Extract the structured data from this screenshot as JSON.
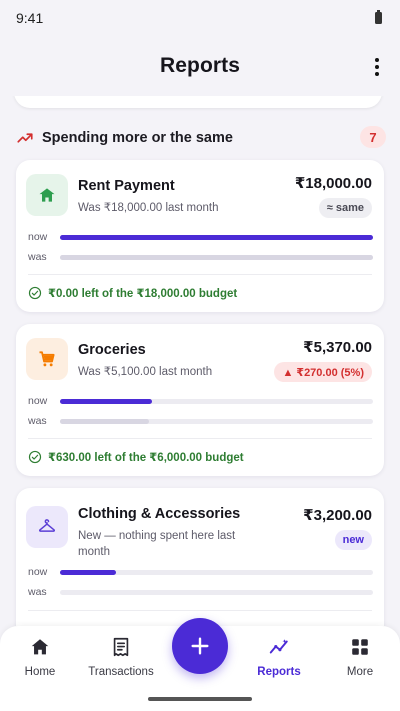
{
  "status_bar": {
    "time": "9:41"
  },
  "app_bar": {
    "title": "Reports"
  },
  "section": {
    "title": "Spending more or the same",
    "count": "7"
  },
  "cards": [
    {
      "name": "Rent Payment",
      "subtitle": "Was ₹18,000.00 last month",
      "amount": "₹18,000.00",
      "badge": "≈ same",
      "now_label": "now",
      "was_label": "was",
      "now_fraction": 1.0,
      "was_fraction": 1.0,
      "budget_text": "₹0.00 left of the ₹18,000.00 budget",
      "icon": "home-icon",
      "icon_color": "#2e9e4f"
    },
    {
      "name": "Groceries",
      "subtitle": "Was ₹5,100.00 last month",
      "amount": "₹5,370.00",
      "badge": "▲ ₹270.00 (5%)",
      "now_label": "now",
      "was_label": "was",
      "now_fraction": 0.295,
      "was_fraction": 0.285,
      "budget_text": "₹630.00 left of the ₹6,000.00 budget",
      "icon": "shopping-cart-icon",
      "icon_color": "#f57c00"
    },
    {
      "name": "Clothing & Accessories",
      "subtitle": "New — nothing spent here last month",
      "amount": "₹3,200.00",
      "badge": "new",
      "now_label": "now",
      "was_label": "was",
      "now_fraction": 0.18,
      "was_fraction": 0,
      "icon": "hanger-icon",
      "icon_color": "#5b3fd6"
    }
  ],
  "bottom_nav": {
    "items": [
      {
        "label": "Home",
        "icon": "home-icon"
      },
      {
        "label": "Transactions",
        "icon": "receipt-icon"
      },
      {
        "label": "Reports",
        "icon": "chart-icon",
        "active": true
      },
      {
        "label": "More",
        "icon": "grid-icon"
      }
    ],
    "fab_icon": "plus-icon"
  },
  "colors": {
    "accent": "#4b2bd6",
    "positive": "#2e7d32",
    "negative": "#d32f2f"
  }
}
